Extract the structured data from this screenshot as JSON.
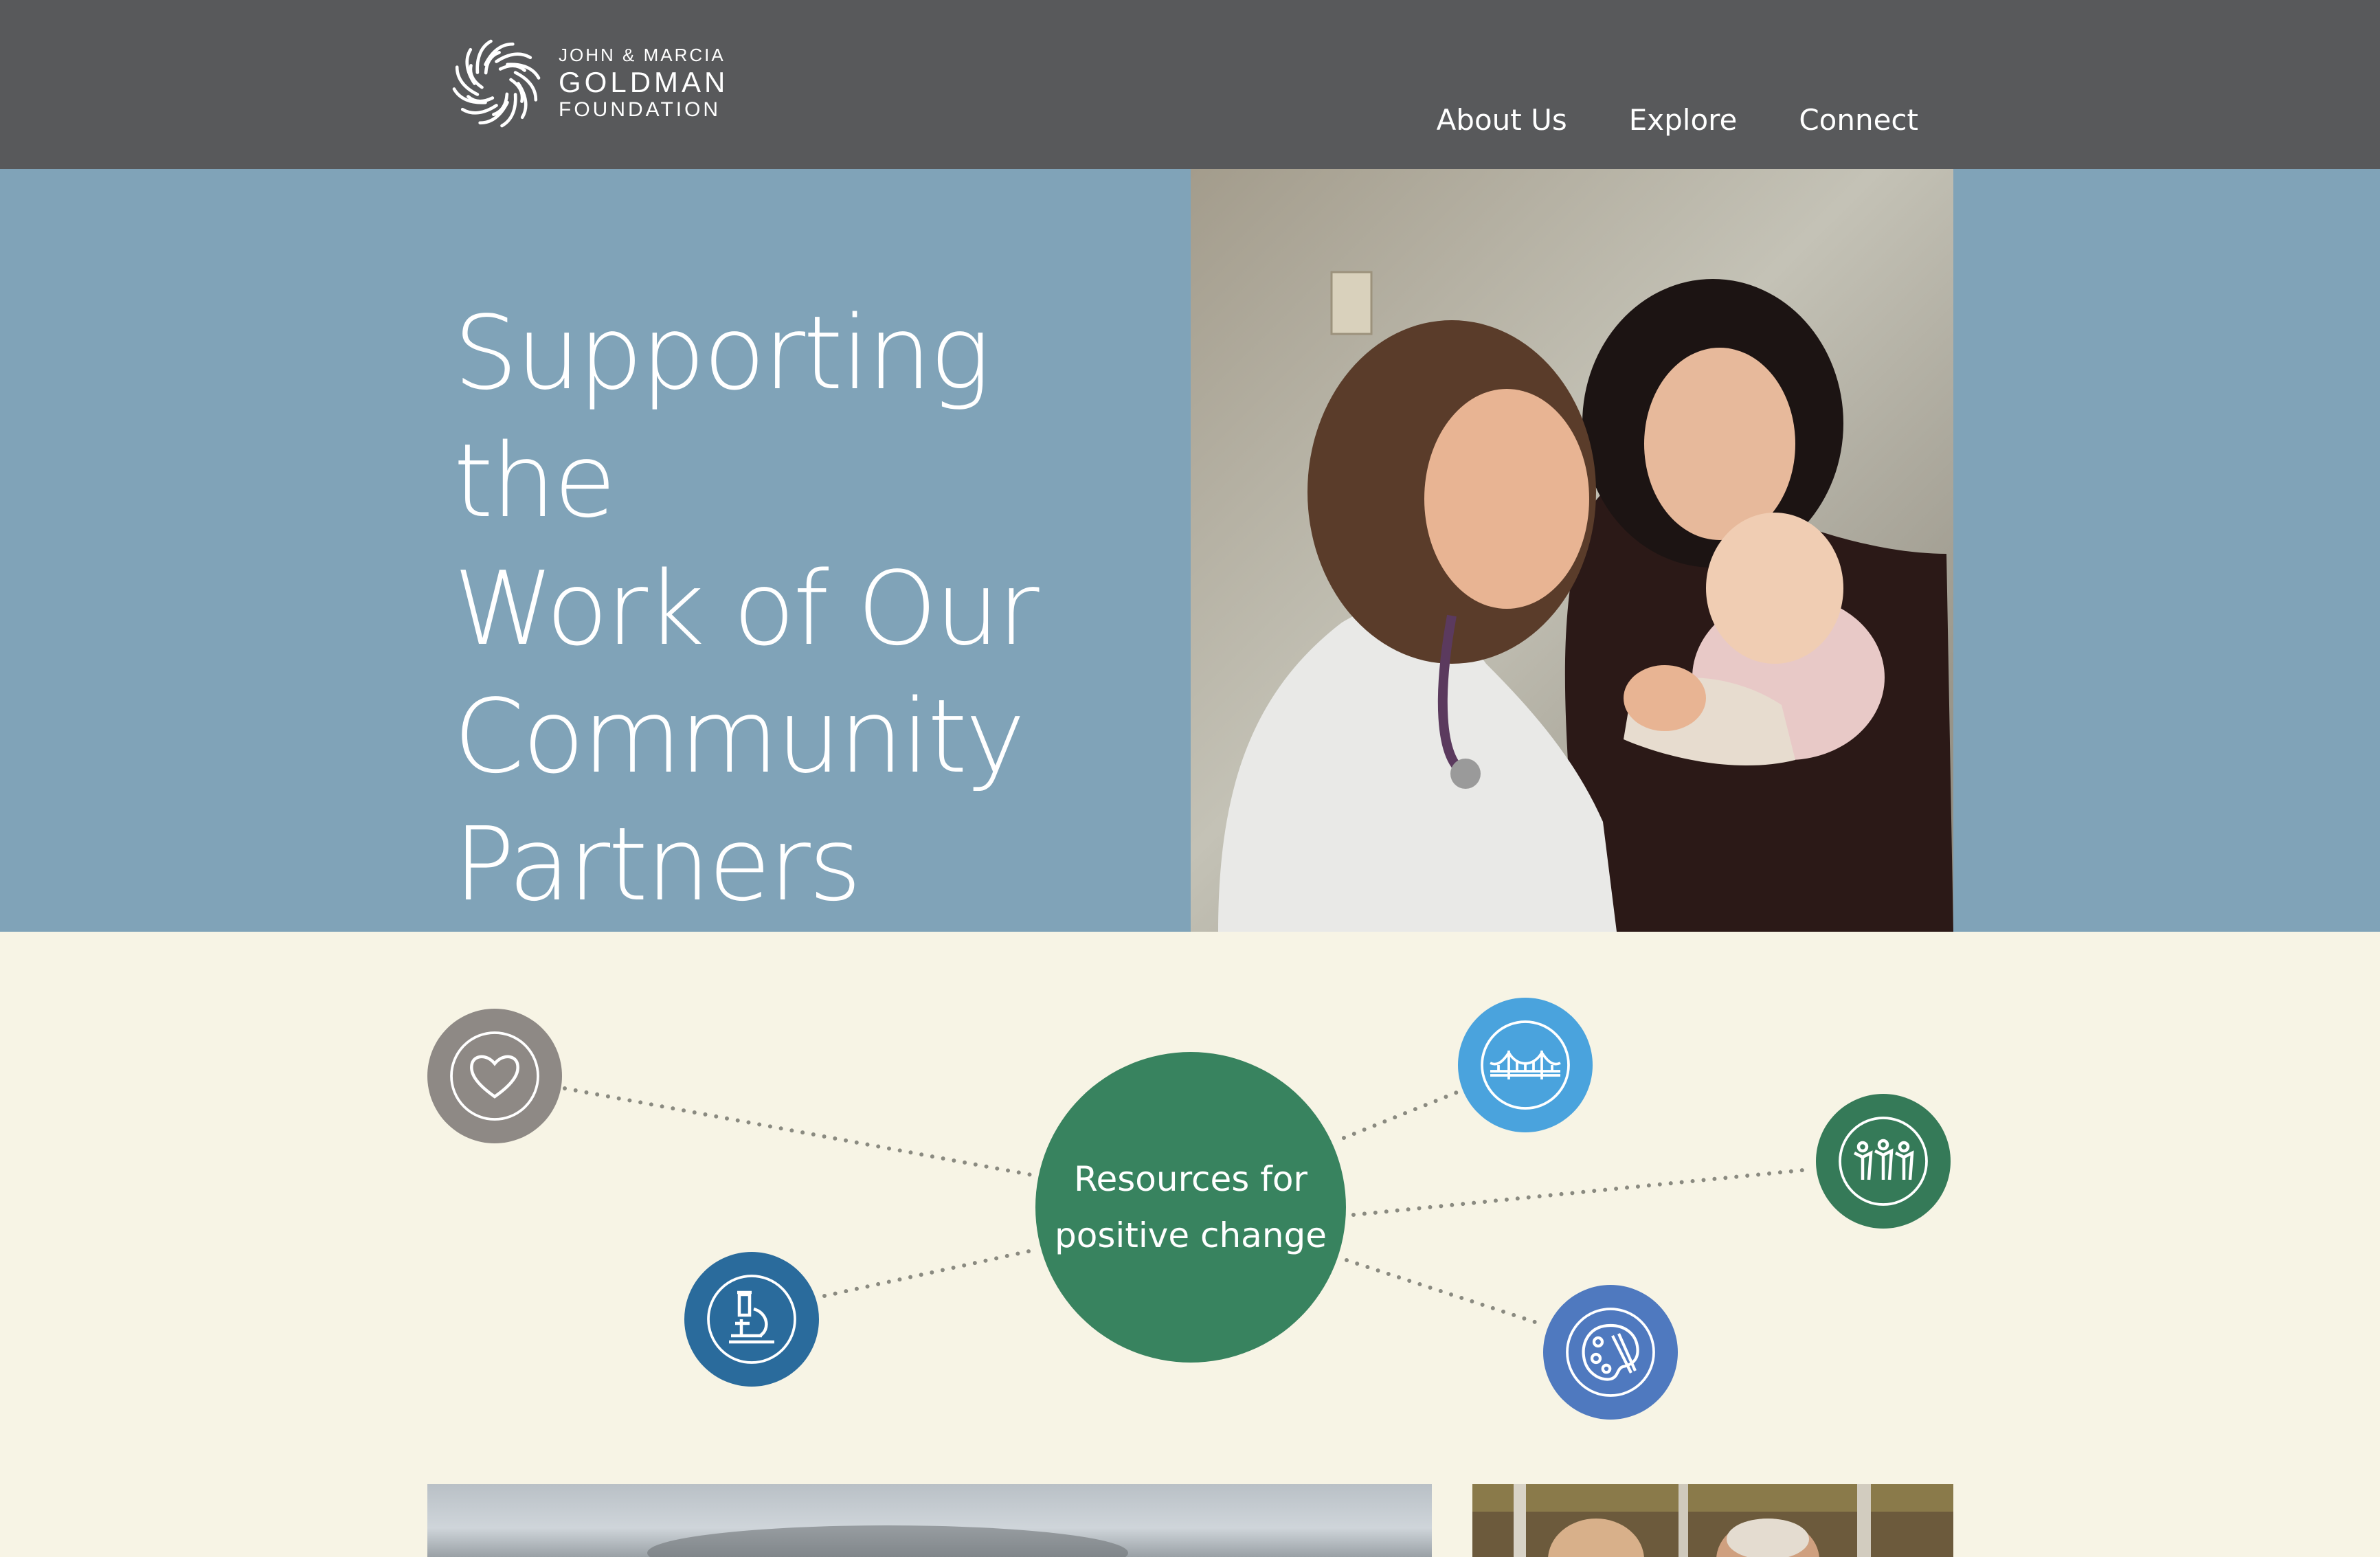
{
  "header": {
    "logo": {
      "line1": "JOHN & MARCIA",
      "line2": "GOLDMAN",
      "line3": "FOUNDATION"
    },
    "nav": [
      {
        "label": "About Us"
      },
      {
        "label": "Explore"
      },
      {
        "label": "Connect"
      }
    ],
    "background": "#58595b"
  },
  "hero": {
    "title_lines": [
      "Supporting the",
      "Work of Our",
      "Community",
      "Partners"
    ],
    "background": "#80a3b8"
  },
  "network": {
    "center": {
      "line1": "Resources for",
      "line2": "positive change",
      "color": "#38835f"
    },
    "nodes": [
      {
        "icon": "heart-icon",
        "color": "#8e8985"
      },
      {
        "icon": "microscope-icon",
        "color": "#2a6b9c"
      },
      {
        "icon": "bridge-icon",
        "color": "#4aa3dd"
      },
      {
        "icon": "people-icon",
        "color": "#357a58"
      },
      {
        "icon": "palette-icon",
        "color": "#4f79bf"
      }
    ],
    "background": "#f7f4e5"
  }
}
